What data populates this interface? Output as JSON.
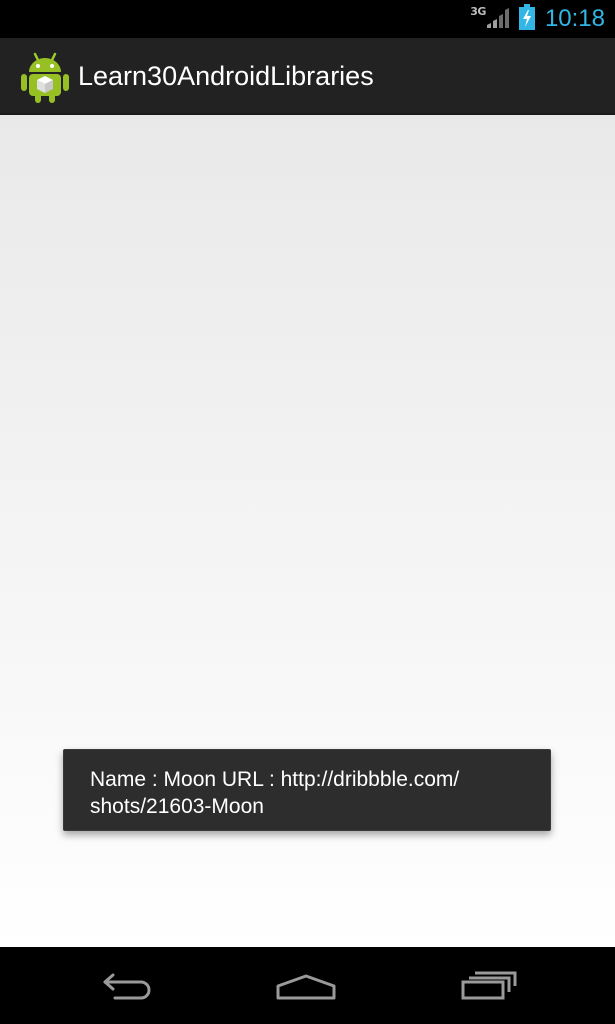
{
  "status_bar": {
    "network_type": "3G",
    "signal_icon": "signal-bars-icon",
    "battery_icon": "battery-charging-icon",
    "time": "10:18",
    "accent_color": "#33b5e5"
  },
  "action_bar": {
    "app_icon": "android-robot-icon",
    "title": "Learn30AndroidLibraries"
  },
  "toast": {
    "line1": "Name : Moon URL : http://dribbble.com/",
    "line2": "shots/21603-Moon"
  },
  "nav_bar": {
    "back_icon": "back-arrow-icon",
    "home_icon": "home-icon",
    "recent_icon": "recent-apps-icon"
  }
}
